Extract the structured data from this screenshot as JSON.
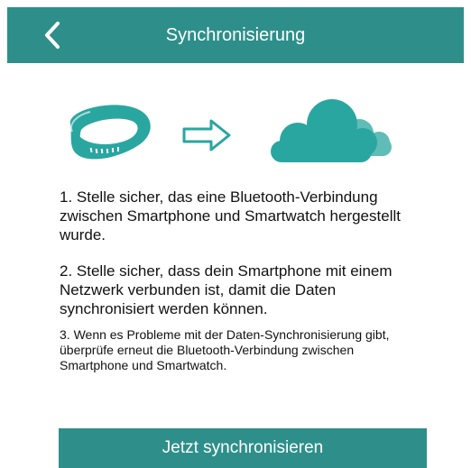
{
  "header": {
    "title": "Synchronisierung",
    "back_icon": "chevron-left-icon"
  },
  "illustration": {
    "icons": [
      "fitness-band-icon",
      "arrow-right-icon",
      "cloud-icon"
    ]
  },
  "steps": [
    "1. Stelle sicher, das eine Bluetooth-Verbindung zwischen Smartphone und Smartwatch hergestellt wurde.",
    "2. Stelle sicher, dass dein Smartphone mit einem Netzwerk verbunden ist, damit die Daten synchronisiert werden können.",
    "3. Wenn es Probleme mit der Daten-Synchronisierung gibt, überprüfe erneut die Bluetooth-Verbindung zwischen Smartphone und Smartwatch."
  ],
  "sync_button": {
    "label": "Jetzt synchronisieren"
  },
  "colors": {
    "primary": "#2e8f8a",
    "icon_teal": "#2aa6a0",
    "text": "#111111",
    "background": "#ffffff"
  }
}
